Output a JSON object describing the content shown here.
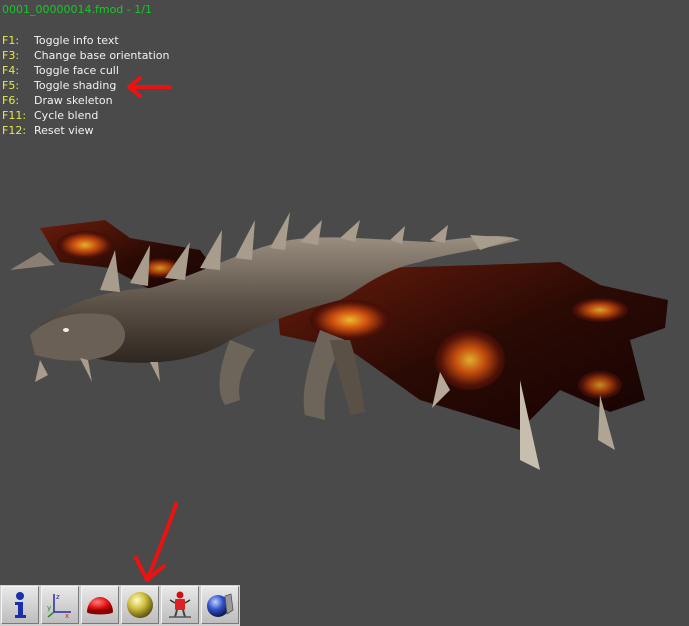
{
  "file_title": "0001_00000014.fmod - 1/1",
  "help": [
    {
      "key": "F1:",
      "desc": "Toggle info text"
    },
    {
      "key": "F3:",
      "desc": "Change base orientation"
    },
    {
      "key": "F4:",
      "desc": "Toggle face cull"
    },
    {
      "key": "F5:",
      "desc": "Toggle shading"
    },
    {
      "key": "F6:",
      "desc": "Draw skeleton"
    },
    {
      "key": "F11:",
      "desc": "Cycle blend"
    },
    {
      "key": "F12:",
      "desc": "Reset view"
    }
  ],
  "colors": {
    "background": "#4a4a4a",
    "title": "#11cc22",
    "key": "#e8e84a",
    "text": "#f2f2f2",
    "annotation": "#ee1111"
  },
  "toolbar": {
    "buttons": [
      {
        "name": "info-icon"
      },
      {
        "name": "axes-icon"
      },
      {
        "name": "face-cull-icon"
      },
      {
        "name": "shading-sphere-icon"
      },
      {
        "name": "skeleton-icon"
      },
      {
        "name": "blend-sphere-icon"
      }
    ]
  }
}
